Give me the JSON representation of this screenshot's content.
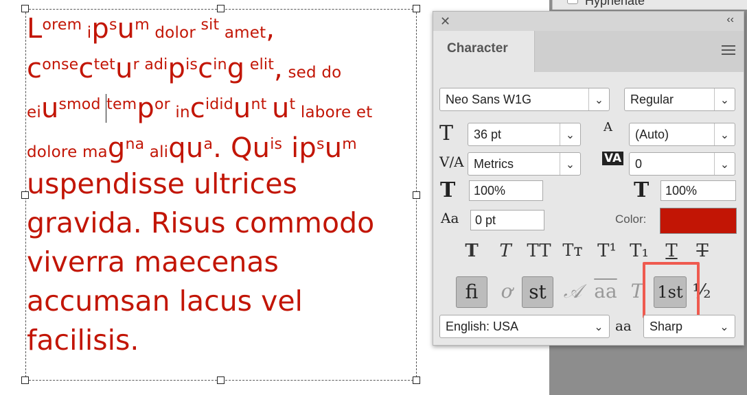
{
  "background_panel": {
    "partial_label": "Hyphenate"
  },
  "text_frame": {
    "lines_small": [
      [
        {
          "t": "L",
          "c": "big"
        },
        {
          "t": "orem",
          "c": "sup"
        },
        {
          "t": " i",
          "c": ""
        },
        {
          "t": "p",
          "c": "big"
        },
        {
          "t": "s",
          "c": "sup"
        },
        {
          "t": "u",
          "c": "big"
        },
        {
          "t": "m",
          "c": "sup"
        },
        {
          "t": " dolor ",
          "c": ""
        },
        {
          "t": "sit",
          "c": "sup"
        },
        {
          "t": " amet",
          "c": ""
        },
        {
          "t": ",",
          "c": "big"
        }
      ],
      [
        {
          "t": "c",
          "c": "big"
        },
        {
          "t": "onse",
          "c": "sup"
        },
        {
          "t": "c",
          "c": "big"
        },
        {
          "t": "tet",
          "c": "sup"
        },
        {
          "t": "u",
          "c": "big"
        },
        {
          "t": "r",
          "c": "sup"
        },
        {
          "t": " ",
          "c": ""
        },
        {
          "t": "adi",
          "c": "sup"
        },
        {
          "t": "p",
          "c": "big"
        },
        {
          "t": "is",
          "c": "sup"
        },
        {
          "t": "c",
          "c": "big"
        },
        {
          "t": "in",
          "c": "sup"
        },
        {
          "t": "g",
          "c": "big"
        },
        {
          "t": " ",
          "c": ""
        },
        {
          "t": "elit",
          "c": "sup"
        },
        {
          "t": ",",
          "c": "big"
        },
        {
          "t": " sed do",
          "c": ""
        }
      ],
      [
        {
          "t": "ei",
          "c": ""
        },
        {
          "t": "u",
          "c": "big"
        },
        {
          "t": "smod",
          "c": "sup"
        },
        {
          "t": " ",
          "c": ""
        },
        {
          "t": "|",
          "c": "caret"
        },
        {
          "t": "tem",
          "c": "sup"
        },
        {
          "t": "p",
          "c": "big"
        },
        {
          "t": "or",
          "c": "sup"
        },
        {
          "t": " in",
          "c": ""
        },
        {
          "t": "c",
          "c": "big"
        },
        {
          "t": "idid",
          "c": "sup"
        },
        {
          "t": "u",
          "c": "big"
        },
        {
          "t": "nt",
          "c": "sup"
        },
        {
          "t": " ",
          "c": ""
        },
        {
          "t": "u",
          "c": "big"
        },
        {
          "t": "t",
          "c": "sup"
        },
        {
          "t": " labore et",
          "c": ""
        }
      ],
      [
        {
          "t": "dolore ma",
          "c": ""
        },
        {
          "t": "g",
          "c": "big"
        },
        {
          "t": "na",
          "c": "sup"
        },
        {
          "t": " ali",
          "c": ""
        },
        {
          "t": "qu",
          "c": "big"
        },
        {
          "t": "a",
          "c": "sup"
        },
        {
          "t": ". Q",
          "c": "big"
        },
        {
          "t": "u",
          "c": "big"
        },
        {
          "t": "is",
          "c": "sup"
        },
        {
          "t": " i",
          "c": "big"
        },
        {
          "t": "p",
          "c": "big"
        },
        {
          "t": "s",
          "c": "sup"
        },
        {
          "t": "u",
          "c": "big"
        },
        {
          "t": "m",
          "c": "sup"
        }
      ]
    ],
    "lines_large": [
      "uspendisse ultrices",
      "gravida. Risus commodo",
      "viverra maecenas",
      "accumsan lacus vel",
      "facilisis."
    ]
  },
  "panel": {
    "tab_label": "Character",
    "font_family": "Neo Sans W1G",
    "font_style": "Regular",
    "font_size": "36 pt",
    "leading": "(Auto)",
    "kerning": "Metrics",
    "tracking": "0",
    "vertical_scale": "100%",
    "horizontal_scale": "100%",
    "baseline_shift": "0 pt",
    "color_label": "Color:",
    "color_value": "#c21505",
    "language": "English: USA",
    "antialias": "Sharp",
    "chevron": "⌄",
    "icons": {
      "close": "✕",
      "collapse": "‹‹",
      "font_size_icon": "T",
      "leading_icon": "A",
      "kerning_icon": "V/A",
      "tracking_icon": "VA",
      "vscale_icon": "T",
      "hscale_icon": "T",
      "baseline_icon": "Aa",
      "antialias_icon": "aa"
    },
    "type_styles": [
      "T",
      "T",
      "TT",
      "Tт",
      "T¹",
      "T₁",
      "T",
      "T"
    ],
    "opentype_features": [
      "fi",
      "ơ",
      "st",
      "𝒜",
      "aa",
      "T",
      "1st",
      "½"
    ]
  }
}
